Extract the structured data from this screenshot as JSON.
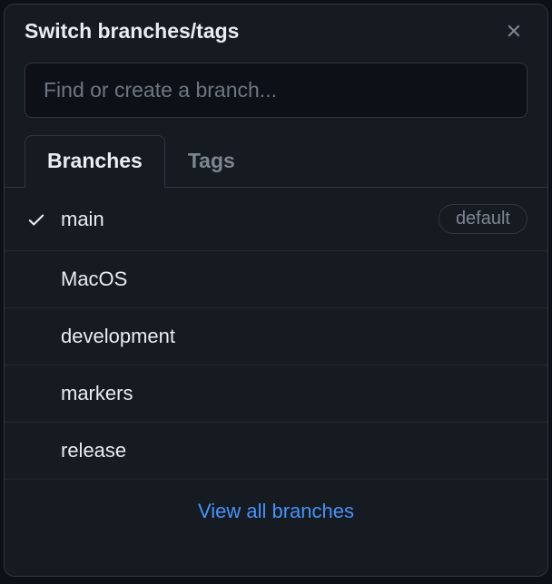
{
  "header": {
    "title": "Switch branches/tags"
  },
  "search": {
    "placeholder": "Find or create a branch..."
  },
  "tabs": {
    "branches": "Branches",
    "tags": "Tags"
  },
  "branches": [
    {
      "name": "main",
      "selected": true,
      "default": true
    },
    {
      "name": "MacOS",
      "selected": false,
      "default": false
    },
    {
      "name": "development",
      "selected": false,
      "default": false
    },
    {
      "name": "markers",
      "selected": false,
      "default": false
    },
    {
      "name": "release",
      "selected": false,
      "default": false
    }
  ],
  "badges": {
    "default_label": "default"
  },
  "footer": {
    "view_all": "View all branches"
  }
}
